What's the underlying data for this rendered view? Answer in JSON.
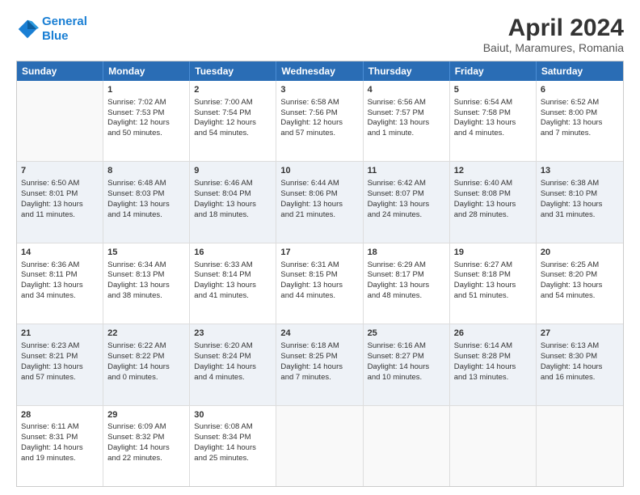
{
  "logo": {
    "line1": "General",
    "line2": "Blue"
  },
  "title": "April 2024",
  "subtitle": "Baiut, Maramures, Romania",
  "days": [
    "Sunday",
    "Monday",
    "Tuesday",
    "Wednesday",
    "Thursday",
    "Friday",
    "Saturday"
  ],
  "weeks": [
    [
      {
        "day": "",
        "info": ""
      },
      {
        "day": "1",
        "info": "Sunrise: 7:02 AM\nSunset: 7:53 PM\nDaylight: 12 hours\nand 50 minutes."
      },
      {
        "day": "2",
        "info": "Sunrise: 7:00 AM\nSunset: 7:54 PM\nDaylight: 12 hours\nand 54 minutes."
      },
      {
        "day": "3",
        "info": "Sunrise: 6:58 AM\nSunset: 7:56 PM\nDaylight: 12 hours\nand 57 minutes."
      },
      {
        "day": "4",
        "info": "Sunrise: 6:56 AM\nSunset: 7:57 PM\nDaylight: 13 hours\nand 1 minute."
      },
      {
        "day": "5",
        "info": "Sunrise: 6:54 AM\nSunset: 7:58 PM\nDaylight: 13 hours\nand 4 minutes."
      },
      {
        "day": "6",
        "info": "Sunrise: 6:52 AM\nSunset: 8:00 PM\nDaylight: 13 hours\nand 7 minutes."
      }
    ],
    [
      {
        "day": "7",
        "info": "Sunrise: 6:50 AM\nSunset: 8:01 PM\nDaylight: 13 hours\nand 11 minutes."
      },
      {
        "day": "8",
        "info": "Sunrise: 6:48 AM\nSunset: 8:03 PM\nDaylight: 13 hours\nand 14 minutes."
      },
      {
        "day": "9",
        "info": "Sunrise: 6:46 AM\nSunset: 8:04 PM\nDaylight: 13 hours\nand 18 minutes."
      },
      {
        "day": "10",
        "info": "Sunrise: 6:44 AM\nSunset: 8:06 PM\nDaylight: 13 hours\nand 21 minutes."
      },
      {
        "day": "11",
        "info": "Sunrise: 6:42 AM\nSunset: 8:07 PM\nDaylight: 13 hours\nand 24 minutes."
      },
      {
        "day": "12",
        "info": "Sunrise: 6:40 AM\nSunset: 8:08 PM\nDaylight: 13 hours\nand 28 minutes."
      },
      {
        "day": "13",
        "info": "Sunrise: 6:38 AM\nSunset: 8:10 PM\nDaylight: 13 hours\nand 31 minutes."
      }
    ],
    [
      {
        "day": "14",
        "info": "Sunrise: 6:36 AM\nSunset: 8:11 PM\nDaylight: 13 hours\nand 34 minutes."
      },
      {
        "day": "15",
        "info": "Sunrise: 6:34 AM\nSunset: 8:13 PM\nDaylight: 13 hours\nand 38 minutes."
      },
      {
        "day": "16",
        "info": "Sunrise: 6:33 AM\nSunset: 8:14 PM\nDaylight: 13 hours\nand 41 minutes."
      },
      {
        "day": "17",
        "info": "Sunrise: 6:31 AM\nSunset: 8:15 PM\nDaylight: 13 hours\nand 44 minutes."
      },
      {
        "day": "18",
        "info": "Sunrise: 6:29 AM\nSunset: 8:17 PM\nDaylight: 13 hours\nand 48 minutes."
      },
      {
        "day": "19",
        "info": "Sunrise: 6:27 AM\nSunset: 8:18 PM\nDaylight: 13 hours\nand 51 minutes."
      },
      {
        "day": "20",
        "info": "Sunrise: 6:25 AM\nSunset: 8:20 PM\nDaylight: 13 hours\nand 54 minutes."
      }
    ],
    [
      {
        "day": "21",
        "info": "Sunrise: 6:23 AM\nSunset: 8:21 PM\nDaylight: 13 hours\nand 57 minutes."
      },
      {
        "day": "22",
        "info": "Sunrise: 6:22 AM\nSunset: 8:22 PM\nDaylight: 14 hours\nand 0 minutes."
      },
      {
        "day": "23",
        "info": "Sunrise: 6:20 AM\nSunset: 8:24 PM\nDaylight: 14 hours\nand 4 minutes."
      },
      {
        "day": "24",
        "info": "Sunrise: 6:18 AM\nSunset: 8:25 PM\nDaylight: 14 hours\nand 7 minutes."
      },
      {
        "day": "25",
        "info": "Sunrise: 6:16 AM\nSunset: 8:27 PM\nDaylight: 14 hours\nand 10 minutes."
      },
      {
        "day": "26",
        "info": "Sunrise: 6:14 AM\nSunset: 8:28 PM\nDaylight: 14 hours\nand 13 minutes."
      },
      {
        "day": "27",
        "info": "Sunrise: 6:13 AM\nSunset: 8:30 PM\nDaylight: 14 hours\nand 16 minutes."
      }
    ],
    [
      {
        "day": "28",
        "info": "Sunrise: 6:11 AM\nSunset: 8:31 PM\nDaylight: 14 hours\nand 19 minutes."
      },
      {
        "day": "29",
        "info": "Sunrise: 6:09 AM\nSunset: 8:32 PM\nDaylight: 14 hours\nand 22 minutes."
      },
      {
        "day": "30",
        "info": "Sunrise: 6:08 AM\nSunset: 8:34 PM\nDaylight: 14 hours\nand 25 minutes."
      },
      {
        "day": "",
        "info": ""
      },
      {
        "day": "",
        "info": ""
      },
      {
        "day": "",
        "info": ""
      },
      {
        "day": "",
        "info": ""
      }
    ]
  ]
}
